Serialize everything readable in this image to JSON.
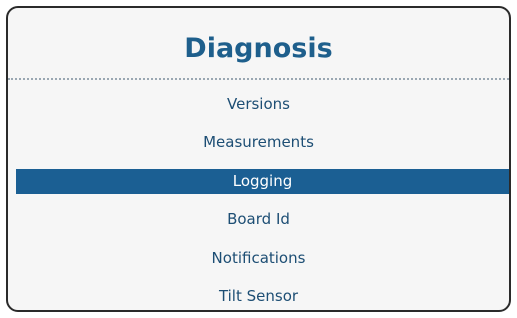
{
  "panel": {
    "title": "Diagnosis"
  },
  "menu": {
    "items": [
      {
        "label": "Versions",
        "selected": false
      },
      {
        "label": "Measurements",
        "selected": false
      },
      {
        "label": "Logging",
        "selected": true
      },
      {
        "label": "Board Id",
        "selected": false
      },
      {
        "label": "Notifications",
        "selected": false
      },
      {
        "label": "Tilt Sensor",
        "selected": false
      }
    ]
  },
  "colors": {
    "title": "#1e5f8c",
    "item_text": "#1d4e74",
    "selection_bg": "#1b5f93",
    "selection_text": "#ffffff",
    "panel_bg": "#f6f6f6",
    "border": "#2a2a2a"
  }
}
